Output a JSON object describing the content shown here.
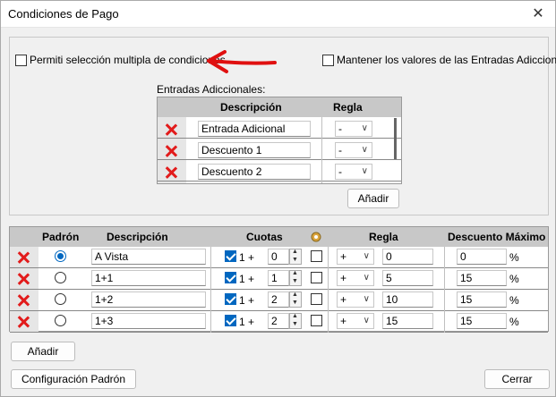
{
  "window": {
    "title": "Condiciones de Pago",
    "close_glyph": "✕"
  },
  "options": {
    "multiple_selection_label": "Permiti selección multipla de condiciones",
    "keep_values_label": "Mantener los valores de las Entradas Adiccional"
  },
  "additional_entries": {
    "section_label": "Entradas Adiccionales:",
    "col_description": "Descripción",
    "col_rule": "Regla",
    "rows": [
      {
        "description": "Entrada Adicional",
        "rule": "-"
      },
      {
        "description": "Descuento 1",
        "rule": "-"
      },
      {
        "description": "Descuento 2",
        "rule": "-"
      }
    ],
    "add_label": "Añadir"
  },
  "conditions": {
    "col_default": "Padrón",
    "col_description": "Descripción",
    "col_installments": "Cuotas",
    "col_rule": "Regla",
    "col_discount": "Descuento Máximo",
    "rows": [
      {
        "selected": true,
        "description": "A Vista",
        "first": "1 +",
        "installments": "0",
        "rule": "+",
        "rule_value": "0",
        "discount": "0",
        "pct": "%"
      },
      {
        "selected": false,
        "description": "1+1",
        "first": "1 +",
        "installments": "1",
        "rule": "+",
        "rule_value": "5",
        "discount": "15",
        "pct": "%"
      },
      {
        "selected": false,
        "description": "1+2",
        "first": "1 +",
        "installments": "2",
        "rule": "+",
        "rule_value": "10",
        "discount": "15",
        "pct": "%"
      },
      {
        "selected": false,
        "description": "1+3",
        "first": "1 +",
        "installments": "2",
        "rule": "+",
        "rule_value": "15",
        "discount": "15",
        "pct": "%"
      }
    ]
  },
  "buttons": {
    "add": "Añadir",
    "default_config": "Configuración Padrón",
    "close": "Cerrar"
  }
}
